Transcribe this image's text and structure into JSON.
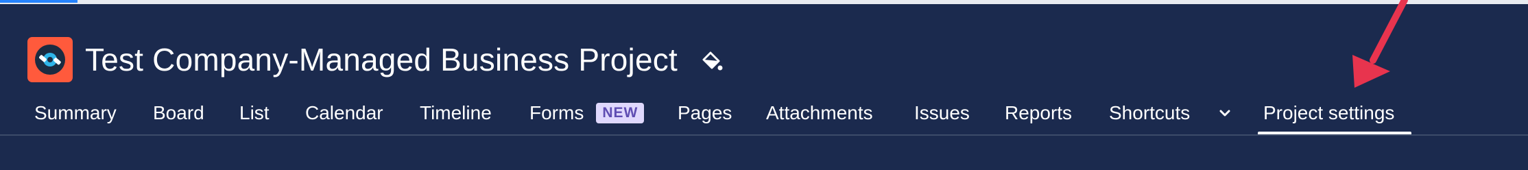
{
  "project": {
    "title": "Test Company-Managed Business Project",
    "avatar_icon": "project-avatar-icon",
    "theme_icon": "paint-bucket-icon"
  },
  "nav": {
    "items": [
      {
        "label": "Summary"
      },
      {
        "label": "Board"
      },
      {
        "label": "List"
      },
      {
        "label": "Calendar"
      },
      {
        "label": "Timeline"
      },
      {
        "label": "Forms",
        "badge": "NEW"
      },
      {
        "label": "Pages"
      },
      {
        "label": "Attachments"
      },
      {
        "label": "Issues"
      },
      {
        "label": "Reports"
      },
      {
        "label": "Shortcuts",
        "icon": "chevron-down-icon"
      },
      {
        "label": "Project settings",
        "active": true
      }
    ]
  },
  "colors": {
    "background": "#1b2a4e",
    "avatar": "#ff5a3c",
    "badge_bg": "#dfd8fd",
    "badge_text": "#5e4db2",
    "annotation_arrow": "#e8344e",
    "loading_bar": "#2684ff"
  }
}
